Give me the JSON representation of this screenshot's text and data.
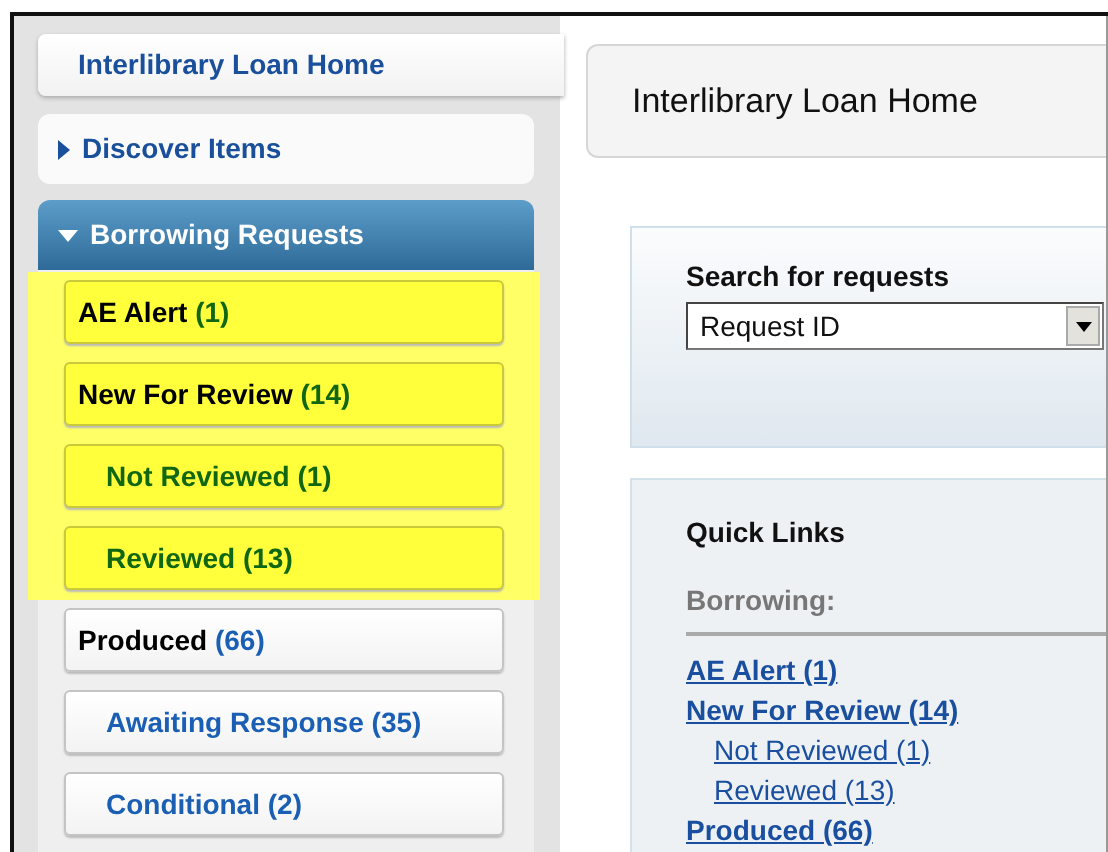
{
  "sidebar": {
    "home": "Interlibrary Loan Home",
    "sections": [
      {
        "label": "Discover Items",
        "expanded": false
      },
      {
        "label": "Borrowing Requests",
        "expanded": true,
        "items": [
          {
            "label": "AE Alert",
            "count": "(1)",
            "highlighted": true
          },
          {
            "label": "New For Review",
            "count": "(14)",
            "highlighted": true,
            "children": [
              {
                "label": "Not Reviewed",
                "count": "(1)",
                "highlighted": true
              },
              {
                "label": "Reviewed",
                "count": "(13)",
                "highlighted": true
              }
            ]
          },
          {
            "label": "Produced",
            "count": "(66)",
            "highlighted": false,
            "children": [
              {
                "label": "Awaiting Response",
                "count": "(35)",
                "highlighted": false
              },
              {
                "label": "Conditional",
                "count": "(2)",
                "highlighted": false
              }
            ]
          }
        ]
      }
    ]
  },
  "main": {
    "title": "Interlibrary Loan Home",
    "search": {
      "heading": "Search for requests",
      "value": "Request ID"
    },
    "quick_links": {
      "heading": "Quick Links",
      "group": "Borrowing:",
      "links": [
        {
          "label": "AE Alert (1)"
        },
        {
          "label": "New For Review (14)",
          "children": [
            {
              "label": "Not Reviewed (1)"
            },
            {
              "label": "Reviewed (13)"
            }
          ]
        },
        {
          "label": "Produced (66)"
        }
      ]
    }
  }
}
